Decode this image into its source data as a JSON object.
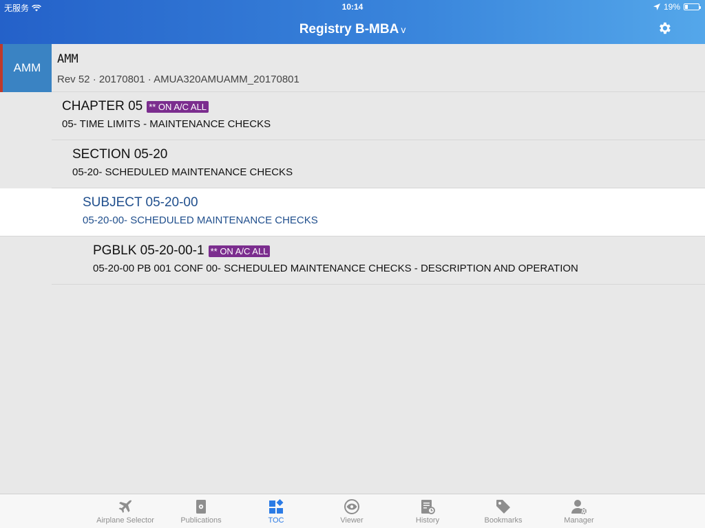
{
  "status_bar": {
    "carrier": "无服务",
    "time": "10:14",
    "battery": "19%",
    "battery_level": 0.19
  },
  "nav": {
    "title": "Registry B-MBA",
    "chevron": "v",
    "settings_icon": "gear-icon"
  },
  "publication": {
    "tile_label": "AMM",
    "title": "AMM",
    "subtitle": "Rev 52 · 20170801 · AMUA320AMUAMM_20170801"
  },
  "toc": [
    {
      "title": "CHAPTER 05",
      "badge": "** ON A/C ALL",
      "subtitle": "05- TIME LIMITS - MAINTENANCE CHECKS"
    },
    {
      "title": "SECTION 05-20",
      "badge": "",
      "subtitle": "05-20- SCHEDULED MAINTENANCE CHECKS"
    },
    {
      "title": "SUBJECT 05-20-00",
      "badge": "",
      "subtitle": "05-20-00- SCHEDULED MAINTENANCE CHECKS"
    },
    {
      "title": "PGBLK 05-20-00-1",
      "badge": "** ON A/C ALL",
      "subtitle": "05-20-00 PB 001 CONF 00- SCHEDULED MAINTENANCE CHECKS - DESCRIPTION AND OPERATION"
    }
  ],
  "tabs": [
    {
      "label": "Airplane Selector",
      "icon": "airplane-icon",
      "active": false
    },
    {
      "label": "Publications",
      "icon": "publications-icon",
      "active": false
    },
    {
      "label": "TOC",
      "icon": "toc-icon",
      "active": true
    },
    {
      "label": "Viewer",
      "icon": "eye-icon",
      "active": false
    },
    {
      "label": "History",
      "icon": "history-icon",
      "active": false
    },
    {
      "label": "Bookmarks",
      "icon": "tag-icon",
      "active": false
    },
    {
      "label": "Manager",
      "icon": "manager-icon",
      "active": false
    }
  ],
  "colors": {
    "nav_start": "#2461c9",
    "nav_end": "#54a7ea",
    "accent": "#2b7be5",
    "badge": "#7b2d8e",
    "tile": "#3a83c3",
    "selected_text": "#1f4e8c"
  }
}
